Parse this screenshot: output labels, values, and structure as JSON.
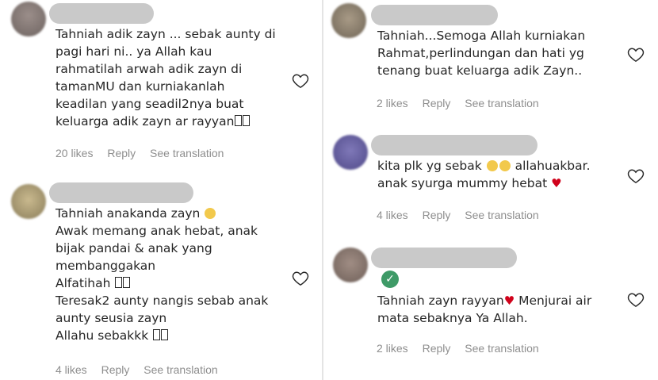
{
  "comments_left": [
    {
      "text": "Tahniah adik zayn ... sebak aunty di\npagi hari ni.. ya Allah kau\nrahmatilah arwah adik zayn di\ntamanMU dan kurniakanlah\nkeadilan yang seadil2nya buat\nkeluarga adik zayn ar rayyan",
      "likes": "20 likes",
      "reply": "Reply",
      "translate": "See translation"
    },
    {
      "text": "Tahniah anakanda zayn",
      "line2": "Awak memang anak hebat, anak\nbijak pandai & anak yang\nmembanggakan",
      "line3": "Alfatihah",
      "line4": "Teresak2 aunty nangis sebab anak\naunty seusia zayn",
      "line5": "Allahu sebakkk",
      "likes": "4 likes",
      "reply": "Reply",
      "translate": "See translation"
    }
  ],
  "comments_right": [
    {
      "text": "Tahniah...Semoga Allah kurniakan\nRahmat,perlindungan dan hati yg\ntenang buat keluarga adik Zayn..",
      "likes": "2 likes",
      "reply": "Reply",
      "translate": "See translation"
    },
    {
      "text_a": "kita plk yg sebak",
      "text_b": "allahuakbar.",
      "text_c": "anak syurga mummy hebat",
      "likes": "4 likes",
      "reply": "Reply",
      "translate": "See translation"
    },
    {
      "text_a": "Tahniah zayn rayyan",
      "text_b": "Menjurai air",
      "text_c": "mata sebaknya Ya Allah.",
      "likes": "2 likes",
      "reply": "Reply",
      "translate": "See translation"
    }
  ],
  "icons": {
    "like": "heart-outline-icon",
    "verified": "checkmark-badge-icon"
  },
  "colors": {
    "meta_text": "#8e8e8e",
    "red_heart": "#d0021b",
    "verified": "#3e9a67"
  }
}
